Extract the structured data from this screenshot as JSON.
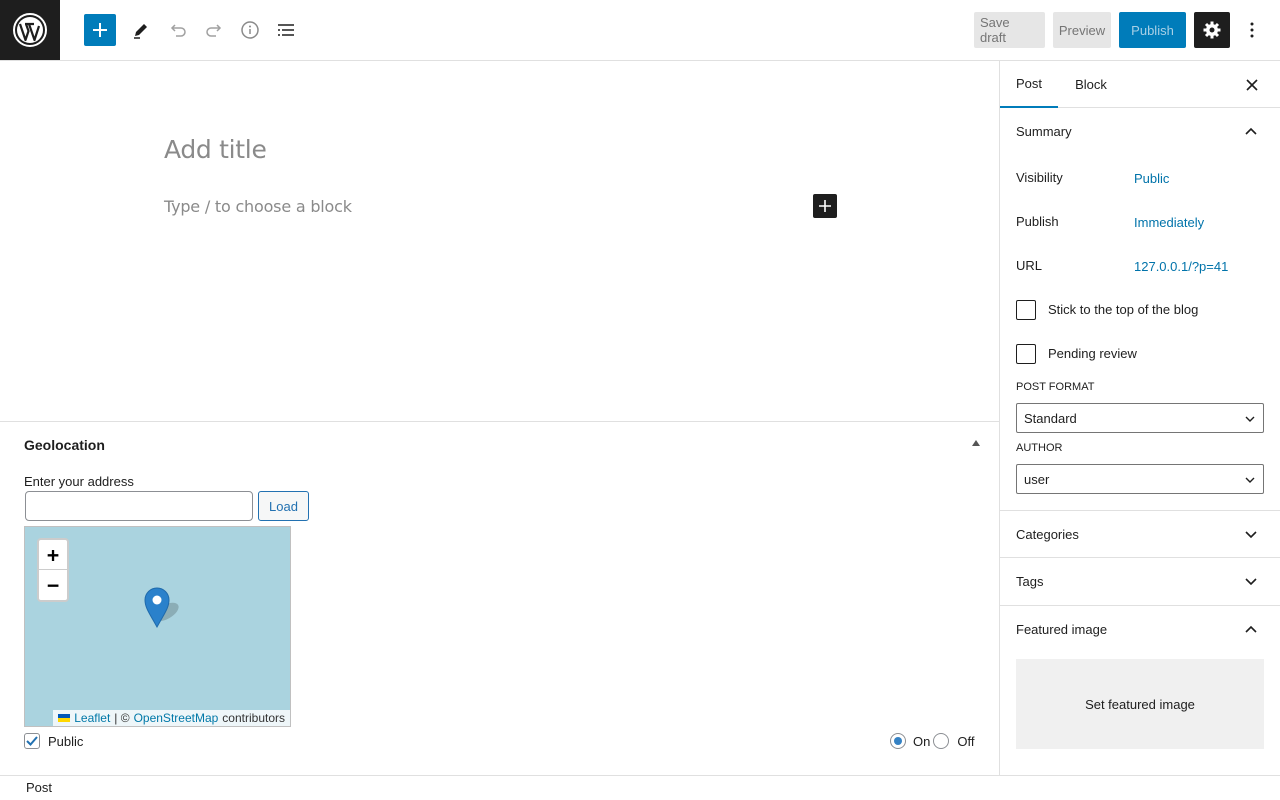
{
  "toolbar": {
    "save_draft": "Save draft",
    "preview": "Preview",
    "publish": "Publish",
    "icons": [
      "wordpress-logo",
      "plus-icon",
      "pencil-icon",
      "undo-icon",
      "redo-icon",
      "info-icon",
      "list-view-icon",
      "gear-icon",
      "more-vertical-icon"
    ]
  },
  "editor": {
    "title_placeholder": "Add title",
    "block_placeholder": "Type / to choose a block"
  },
  "geolocation": {
    "title": "Geolocation",
    "address_label": "Enter your address",
    "address_value": "",
    "load_label": "Load",
    "zoom_in": "+",
    "zoom_out": "−",
    "attribution": {
      "leaflet": "Leaflet",
      "separator": "| ©",
      "osm": "OpenStreetMap",
      "contributors": "contributors"
    },
    "public_label": "Public",
    "public_checked": true,
    "on_label": "On",
    "off_label": "Off",
    "selected": "On"
  },
  "sidebar": {
    "tabs": [
      {
        "label": "Post",
        "active": true
      },
      {
        "label": "Block",
        "active": false
      }
    ],
    "summary": {
      "title": "Summary",
      "visibility_label": "Visibility",
      "visibility_value": "Public",
      "publish_label": "Publish",
      "publish_value": "Immediately",
      "url_label": "URL",
      "url_value": "127.0.0.1/?p=41",
      "sticky_label": "Stick to the top of the blog",
      "pending_label": "Pending review",
      "post_format_label": "POST FORMAT",
      "post_format_value": "Standard",
      "author_label": "AUTHOR",
      "author_value": "user"
    },
    "categories_title": "Categories",
    "tags_title": "Tags",
    "featured_title": "Featured image",
    "featured_button": "Set featured image"
  },
  "footer": {
    "breadcrumb": "Post"
  },
  "colors": {
    "accent": "#007cba",
    "dark": "#1e1e1e",
    "map_water": "#aad3df",
    "link": "#0073aa"
  }
}
